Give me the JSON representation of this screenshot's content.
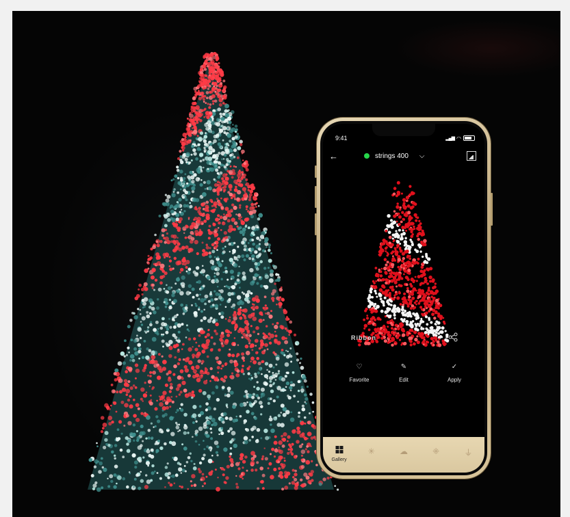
{
  "phone": {
    "status_time": "9:41",
    "back_icon": "arrow-left-icon",
    "device_name": "strings 400",
    "device_status_color": "#26d64a",
    "effect_name": "Ribbon",
    "actions": [
      {
        "icon": "heart-icon",
        "label": "Favorite"
      },
      {
        "icon": "pencil-icon",
        "label": "Edit"
      },
      {
        "icon": "checkmark-icon",
        "label": "Apply"
      }
    ],
    "tabs": [
      {
        "icon": "grid-icon",
        "label": "Gallery",
        "active": true
      },
      {
        "icon": "sparkle-icon",
        "label": ""
      },
      {
        "icon": "cloud-icon",
        "label": ""
      },
      {
        "icon": "dots-grid-icon",
        "label": ""
      },
      {
        "icon": "plug-icon",
        "label": ""
      }
    ]
  },
  "colors": {
    "light_red": "#ff3b46",
    "light_white": "#e9f6f4",
    "foliage": "#3f8f8d",
    "tabbar": "#e2d1aa"
  }
}
